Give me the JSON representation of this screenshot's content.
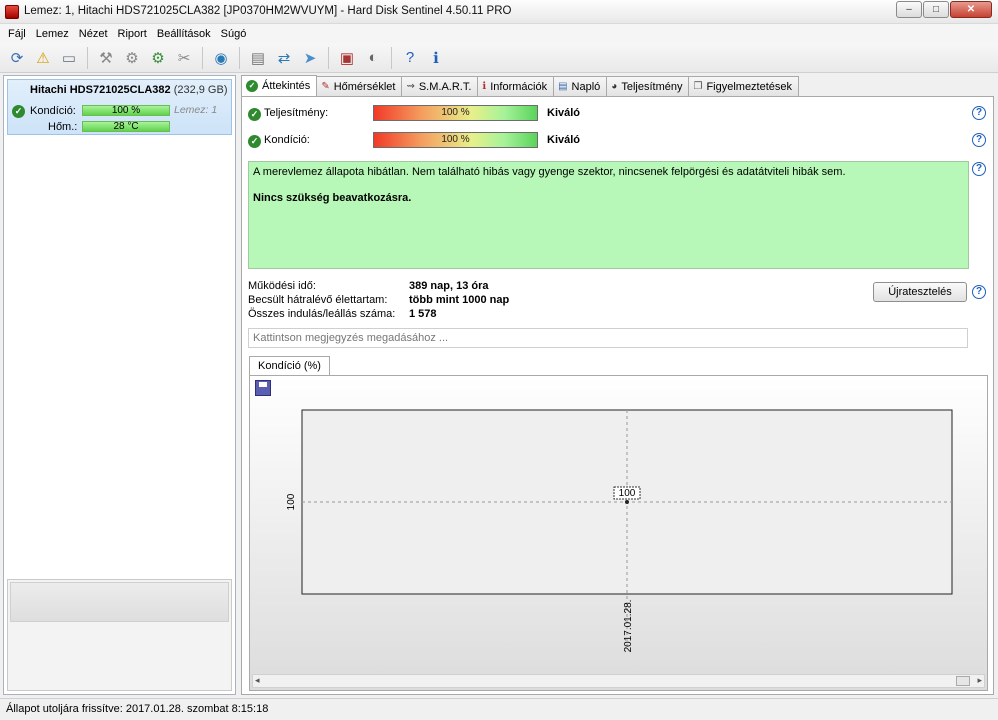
{
  "window": {
    "title": "Lemez: 1, Hitachi HDS721025CLA382 [JP0370HM2WVUYM]  -  Hard Disk Sentinel 4.50.11 PRO",
    "minimize": "‒",
    "maximize": "□",
    "close": "✕"
  },
  "menu": {
    "items": [
      "Fájl",
      "Lemez",
      "Nézet",
      "Riport",
      "Beállítások",
      "Súgó"
    ]
  },
  "toolbar": {
    "icons": [
      "refresh-icon",
      "warning-icon",
      "disk-info-icon",
      "disk-tool-icon",
      "disk-tool-2-icon",
      "disk-tool-3-icon",
      "disk-tool-4-icon",
      "globe-icon",
      "report-icon",
      "sync-icon",
      "send-icon",
      "monitor-icon",
      "audio-icon",
      "help-icon",
      "info-icon"
    ]
  },
  "left_panel": {
    "disk_name": "Hitachi HDS721025CLA382",
    "disk_size": "(232,9 GB)",
    "condition_label": "Kondíció:",
    "condition_value": "100 %",
    "condition_fraction": 1.0,
    "lemez_label": "Lemez: 1",
    "temp_label": "Hőm.:",
    "temp_value": "28 °C"
  },
  "tabs": [
    {
      "label": "Áttekintés",
      "icon": "check-icon",
      "active": true
    },
    {
      "label": "Hőmérséklet",
      "icon": "thermometer-icon",
      "active": false
    },
    {
      "label": "S.M.A.R.T.",
      "icon": "smart-icon",
      "active": false
    },
    {
      "label": "Információk",
      "icon": "info-icon",
      "active": false
    },
    {
      "label": "Napló",
      "icon": "log-icon",
      "active": false
    },
    {
      "label": "Teljesítmény",
      "icon": "performance-icon",
      "active": false
    },
    {
      "label": "Figyelmeztetések",
      "icon": "alerts-icon",
      "active": false
    }
  ],
  "overview": {
    "performance_label": "Teljesítmény:",
    "performance_value": "100 %",
    "performance_fraction": 1.0,
    "performance_rating": "Kiváló",
    "condition_label": "Kondíció:",
    "condition_value": "100 %",
    "condition_fraction": 1.0,
    "condition_rating": "Kiváló",
    "status_message": "A merevlemez állapota hibátlan. Nem található hibás vagy gyenge szektor, nincsenek felpörgési és adatátviteli hibák sem.",
    "status_action": "Nincs szükség beavatkozásra.",
    "uptime_label": "Működési idő:",
    "uptime_value": "389 nap, 13 óra",
    "lifetime_label": "Becsült hátralévő élettartam:",
    "lifetime_value": "több mint 1000 nap",
    "starts_label": "Összes indulás/leállás száma:",
    "starts_value": "1 578",
    "retest_button": "Újratesztelés",
    "note_placeholder": "Kattintson megjegyzés megadásához ..."
  },
  "chart_tab": {
    "label": "Kondíció  (%)"
  },
  "chart_data": {
    "type": "line",
    "x": [
      "2017.01.28."
    ],
    "series": [
      {
        "values": [
          100
        ]
      }
    ],
    "yticks": [
      "100"
    ],
    "xticks": [
      "2017.01.28."
    ],
    "data_labels": [
      "100"
    ],
    "grid": true
  },
  "statusbar": {
    "text": "Állapot utoljára frissítve: 2017.01.28. szombat 8:15:18"
  },
  "colors": {
    "ok_green": "#2f8a2f",
    "status_box_green": "#b7f7b7",
    "selection_blue": "#cde3f8"
  }
}
